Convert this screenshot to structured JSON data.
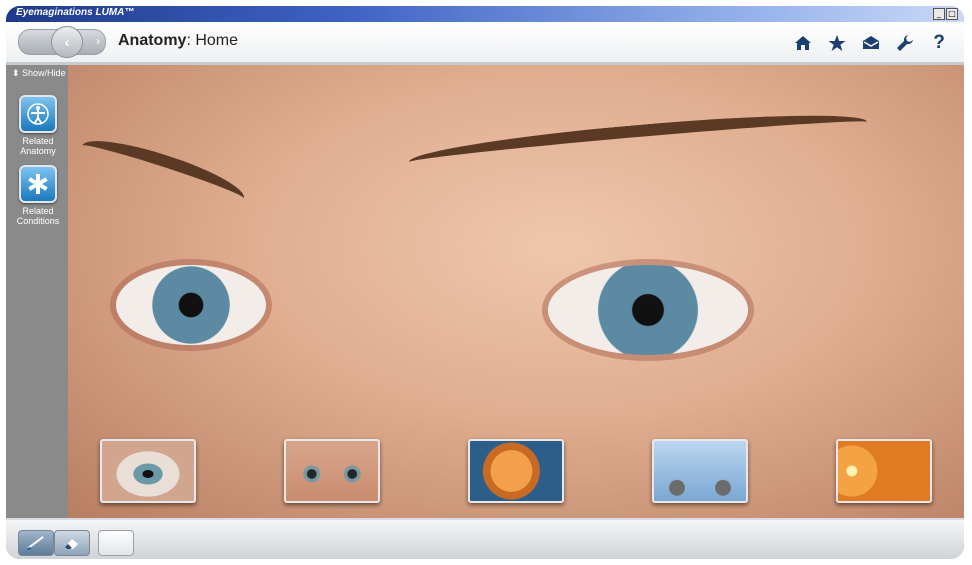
{
  "window": {
    "title": "Eyemaginations LUMA™",
    "buttons": [
      "_",
      "□",
      "×"
    ]
  },
  "toolbar": {
    "section": "Anatomy",
    "page": "Home",
    "icons": [
      "home-icon",
      "star-icon",
      "mail-icon",
      "wrench-icon",
      "help-icon"
    ]
  },
  "sidebar": {
    "toggle": "Show/Hide",
    "items": [
      {
        "label": "Related Anatomy",
        "icon": "vitruvian-icon"
      },
      {
        "label": "Related Conditions",
        "icon": "medical-star-icon"
      }
    ]
  },
  "gallery": {
    "thumbnails": [
      {
        "name": "eye-closeup"
      },
      {
        "name": "eyes-face"
      },
      {
        "name": "eye-cross-section"
      },
      {
        "name": "optic-pathway"
      },
      {
        "name": "retina"
      }
    ]
  },
  "bottom": {
    "tools": [
      "pen-tool",
      "eraser-tool",
      "blank-tool"
    ]
  },
  "colors": {
    "accent": "#1d3f6e",
    "title_bar": "#2f56b8"
  }
}
